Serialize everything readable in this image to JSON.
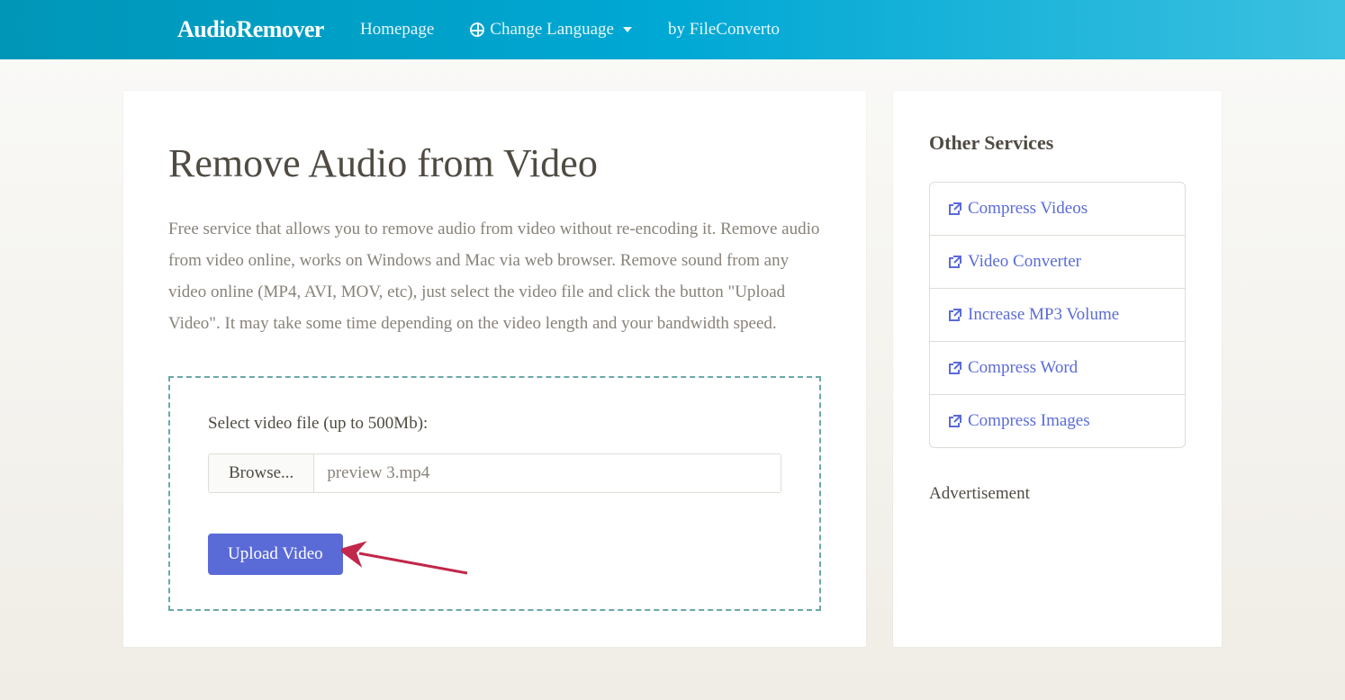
{
  "nav": {
    "brand": "AudioRemover",
    "homepage": "Homepage",
    "change_language": "Change Language",
    "by": "by FileConverto"
  },
  "main": {
    "title": "Remove Audio from Video",
    "description": "Free service that allows you to remove audio from video without re-encoding it. Remove audio from video online, works on Windows and Mac via web browser. Remove sound from any video online (MP4, AVI, MOV, etc), just select the video file and click the button \"Upload Video\". It may take some time depending on the video length and your bandwidth speed.",
    "select_label": "Select video file (up to 500Mb):",
    "browse_label": "Browse...",
    "file_name": "preview 3.mp4",
    "upload_label": "Upload Video"
  },
  "sidebar": {
    "other_services_title": "Other Services",
    "services": [
      {
        "label": "Compress Videos"
      },
      {
        "label": "Video Converter"
      },
      {
        "label": "Increase MP3 Volume"
      },
      {
        "label": "Compress Word"
      },
      {
        "label": "Compress Images"
      }
    ],
    "ad_title": "Advertisement"
  },
  "colors": {
    "accent": "#5a6bd8",
    "nav_bg": "#00a8d4"
  }
}
